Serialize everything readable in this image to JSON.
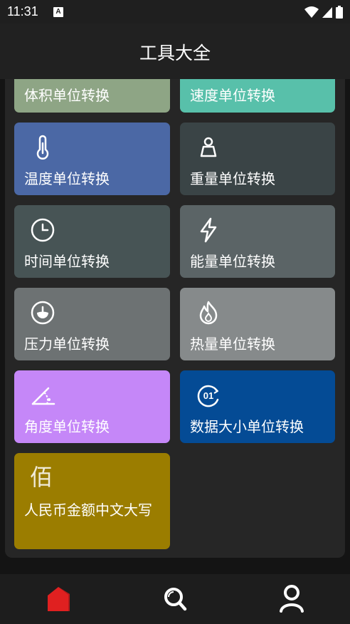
{
  "status_bar": {
    "time": "11:31",
    "notification_icon": "A"
  },
  "app_bar": {
    "title": "工具大全"
  },
  "cards": [
    {
      "label": "体积单位转换",
      "icon": "cube-icon",
      "color": "#8ea585"
    },
    {
      "label": "速度单位转换",
      "icon": "speedometer-icon",
      "color": "#58c0aa"
    },
    {
      "label": "温度单位转换",
      "icon": "thermometer-icon",
      "color": "#4b68a5"
    },
    {
      "label": "重量单位转换",
      "icon": "weight-icon",
      "color": "#3a4446"
    },
    {
      "label": "时间单位转换",
      "icon": "clock-icon",
      "color": "#475455"
    },
    {
      "label": "能量单位转换",
      "icon": "lightning-icon",
      "color": "#5b6466"
    },
    {
      "label": "压力单位转换",
      "icon": "pressure-gauge-icon",
      "color": "#6d7273"
    },
    {
      "label": "热量单位转换",
      "icon": "flame-icon",
      "color": "#868a8b"
    },
    {
      "label": "角度单位转换",
      "icon": "angle-icon",
      "color": "#c587f8"
    },
    {
      "label": "数据大小单位转换",
      "icon": "data-01-icon",
      "color": "#044b95"
    },
    {
      "label": "人民币金额中文大写",
      "icon": "bai-character-icon",
      "icon_text": "佰",
      "color": "#9b7d00"
    }
  ],
  "bottom_nav": [
    {
      "name": "home",
      "icon": "home-icon",
      "active": true,
      "color": "#e02020"
    },
    {
      "name": "search",
      "icon": "search-icon",
      "active": false
    },
    {
      "name": "profile",
      "icon": "person-icon",
      "active": false
    }
  ]
}
